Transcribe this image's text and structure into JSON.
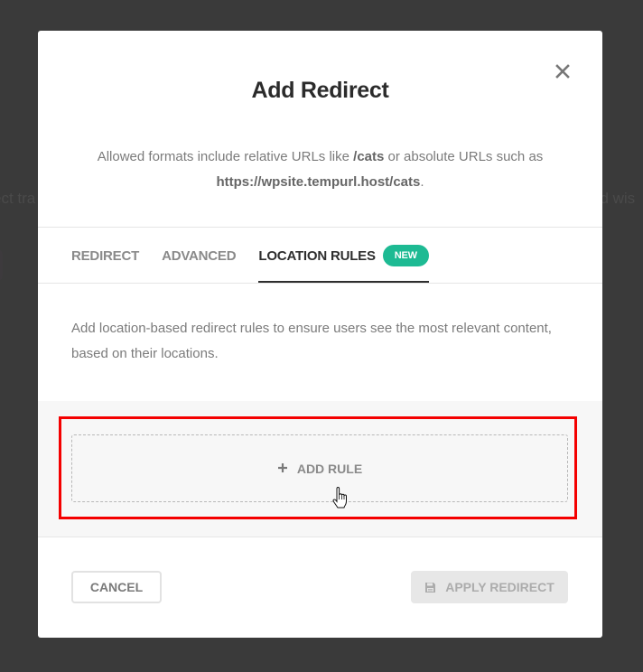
{
  "background": {
    "left_text_fragment": "ect tra",
    "right_text_fragment": "nd wis"
  },
  "modal": {
    "title": "Add Redirect",
    "close_icon": "close-icon",
    "description": {
      "part1": "Allowed formats include relative URLs like ",
      "relative_example": "/cats",
      "part2": " or absolute URLs such as ",
      "absolute_example": "https://wpsite.tempurl.host/cats",
      "part3": "."
    },
    "tabs": [
      {
        "label": "REDIRECT",
        "active": false
      },
      {
        "label": "ADVANCED",
        "active": false
      },
      {
        "label": "LOCATION RULES",
        "active": true,
        "badge": "NEW"
      }
    ],
    "info_text": "Add location-based redirect rules to ensure users see the most relevant content, based on their locations.",
    "add_rule": {
      "icon": "plus-icon",
      "label": "ADD RULE"
    },
    "footer": {
      "cancel_label": "CANCEL",
      "apply_label": "APPLY REDIRECT",
      "apply_icon": "save-icon",
      "apply_disabled": true
    }
  },
  "colors": {
    "badge": "#1dba93",
    "highlight": "#f40000",
    "overlay": "#3a3a3a"
  }
}
